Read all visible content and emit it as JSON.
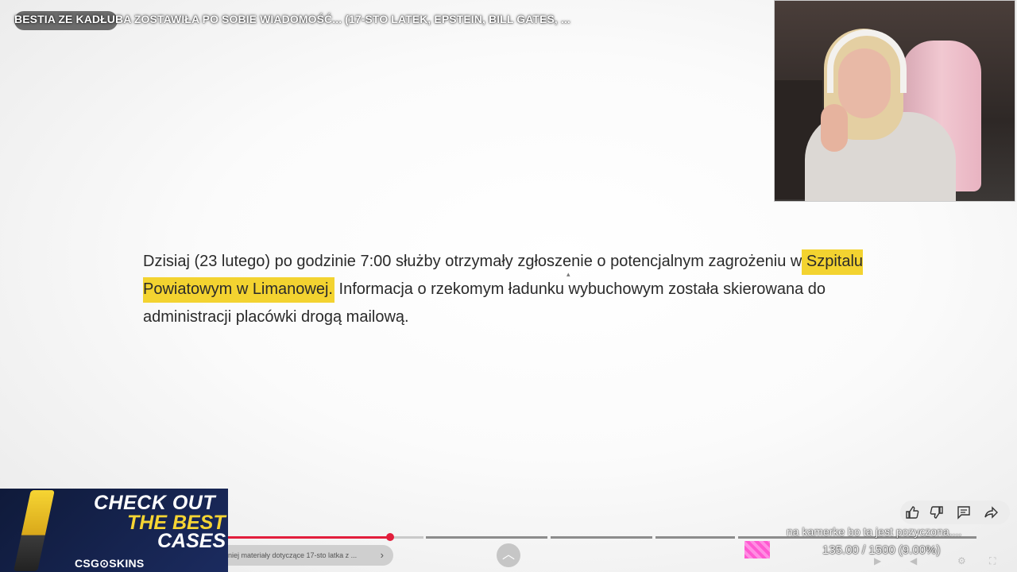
{
  "video": {
    "title": "BESTIA ZE KADŁUBA ZOSTAWIŁA PO SOBIE WIADOMOŚĆ... (17-STO LATEK, EPSTEIN, BILL GATES, ..."
  },
  "article": {
    "text_before": "Dzisiaj (23 lutego) po godzinie 7:00 służby otrzymały zgłoszenie o potencjalnym zagrożeniu w ",
    "highlighted": "Szpitalu Powiatowym w Limanowej.",
    "text_after": " Informacja o rzekomym ładunku wybuchowym została skierowana do administracji placówki drogą mailową."
  },
  "promo": {
    "line1": "CHECK  OUT",
    "line2": "THE BEST",
    "line3": "CASES",
    "brand": "CSG⊙SKINS"
  },
  "player": {
    "progress_fraction": 0.39,
    "chapter_label": "niej materiały dotyczące 17-sto latka z ...",
    "chapter_icon": "chevron-right-icon",
    "expand_icon": "chevron-up-icon",
    "accent_color": "#e21e3c"
  },
  "actions": {
    "like_icon": "thumbs-up-icon",
    "dislike_icon": "thumbs-down-icon",
    "comment_icon": "comment-icon",
    "share_icon": "share-icon"
  },
  "stream_overlay": {
    "message": "na kamerke bo ta jest pozyczona....",
    "goal_text": "135.00 / 1500 (9.00%)",
    "goal_fraction": 0.09,
    "goal_color": "#ff5ad1"
  }
}
